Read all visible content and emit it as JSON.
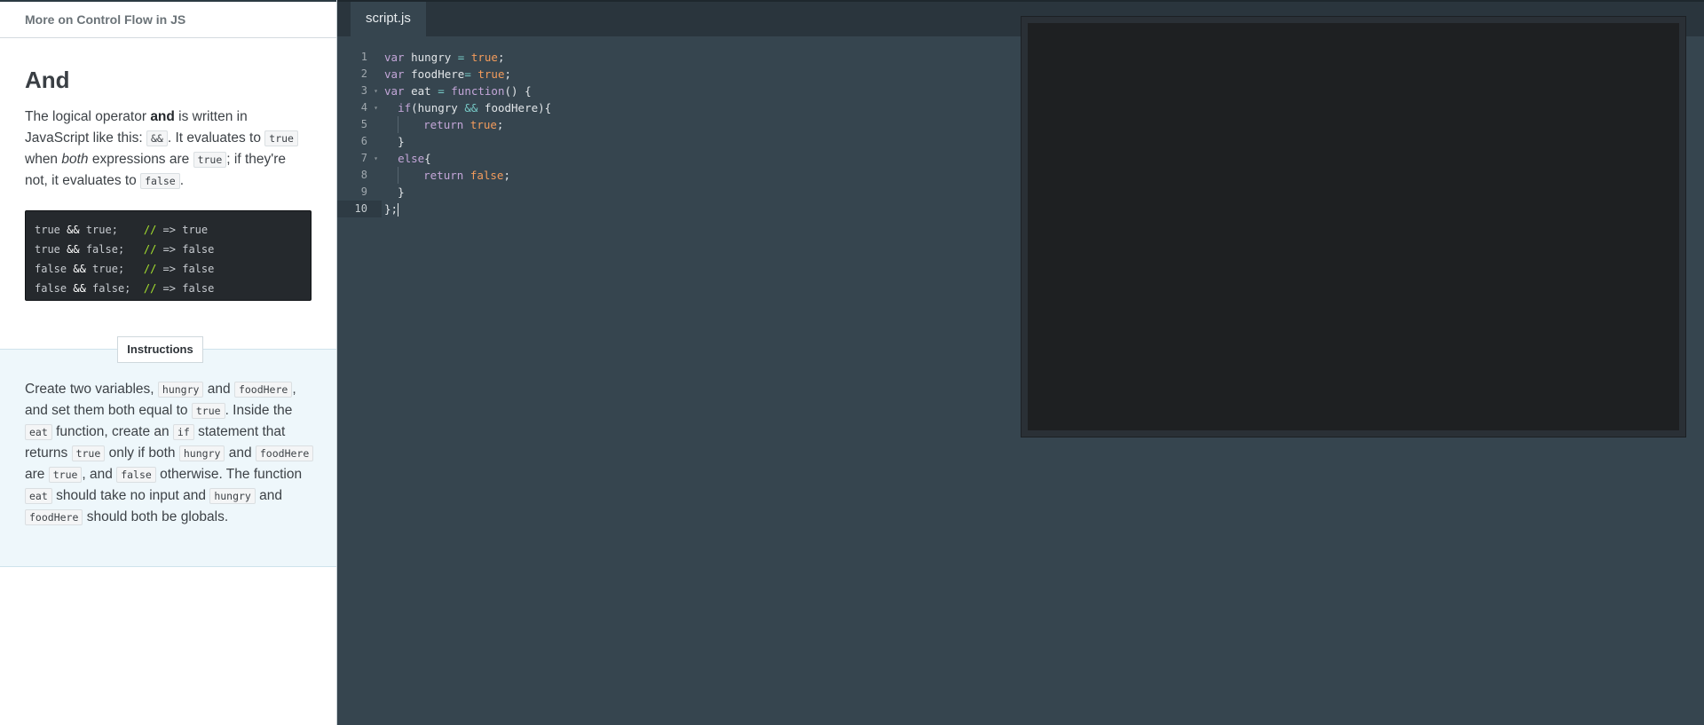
{
  "lesson": {
    "title": "More on Control Flow in JS",
    "section_heading": "And",
    "p1_a": "The logical operator ",
    "p1_bold": "and",
    "p1_b": " is written in JavaScript like this: ",
    "p1_code1": "&&",
    "p1_c": ". It evaluates to ",
    "p1_code2": "true",
    "p1_d": " when ",
    "p1_italic": "both",
    "p1_e": " expressions are ",
    "p1_code3": "true",
    "p1_f": "; if they're not, it evaluates to ",
    "p1_code4": "false",
    "p1_g": ".",
    "example_lines": [
      {
        "a": "true",
        "op": "&&",
        "b": "true;",
        "pad": "    ",
        "comment": "//",
        "arrow": "=>",
        "result": "true"
      },
      {
        "a": "true",
        "op": "&&",
        "b": "false;",
        "pad": "   ",
        "comment": "//",
        "arrow": "=>",
        "result": "false"
      },
      {
        "a": "false",
        "op": "&&",
        "b": "true;",
        "pad": "   ",
        "comment": "//",
        "arrow": "=>",
        "result": "false"
      },
      {
        "a": "false",
        "op": "&&",
        "b": "false;",
        "pad": "  ",
        "comment": "//",
        "arrow": "=>",
        "result": "false"
      }
    ]
  },
  "instructions": {
    "tab_label": "Instructions",
    "t1": "Create two variables, ",
    "c1": "hungry",
    "t2": " and ",
    "c2": "foodHere",
    "t3": ", and set them both equal to ",
    "c3": "true",
    "t4": ". Inside the ",
    "c4": "eat",
    "t5": " function, create an ",
    "c5": "if",
    "t6": " statement that returns ",
    "c6": "true",
    "t7": " only if both ",
    "c7": "hungry",
    "t8": " and ",
    "c8": "foodHere",
    "t9": " are ",
    "c9": "true",
    "t10": ", and ",
    "c10": "false",
    "t11": " otherwise. The function ",
    "c11": "eat",
    "t12": " should take no input and ",
    "c12": "hungry",
    "t13": " and ",
    "c13": "foodHere",
    "t14": " should both be globals."
  },
  "editor": {
    "file_tab": "script.js",
    "line_numbers": [
      "1",
      "2",
      "3",
      "4",
      "5",
      "6",
      "7",
      "8",
      "9",
      "10"
    ],
    "lines": {
      "l1": {
        "k": "var",
        "rest": " hungry ",
        "op": "=",
        "sp": " ",
        "val": "true",
        "end": ";"
      },
      "l2": {
        "k": "var",
        "rest": " foodHere",
        "op": "=",
        "sp": " ",
        "val": "true",
        "end": ";"
      },
      "l3": {
        "k": "var",
        "rest": " eat ",
        "op": "=",
        "sp": " ",
        "fn": "function",
        "end": "() {"
      },
      "l4": {
        "k": "if",
        "a": "(hungry ",
        "op": "&&",
        "b": " foodHere){"
      },
      "l5": {
        "k": "return",
        "sp": " ",
        "val": "true",
        "end": ";"
      },
      "l6": {
        "text": "}"
      },
      "l7": {
        "k": "else",
        "end": "{"
      },
      "l8": {
        "k": "return",
        "sp": " ",
        "val": "false",
        "end": ";"
      },
      "l9": {
        "text": "}"
      },
      "l10": {
        "text": "};"
      }
    }
  },
  "colors": {
    "editor_bg": "#36454f",
    "keyword": "#c3a6d8",
    "boolean": "#f39c5c",
    "operator": "#76c9c6",
    "comment": "#a6e22e"
  }
}
